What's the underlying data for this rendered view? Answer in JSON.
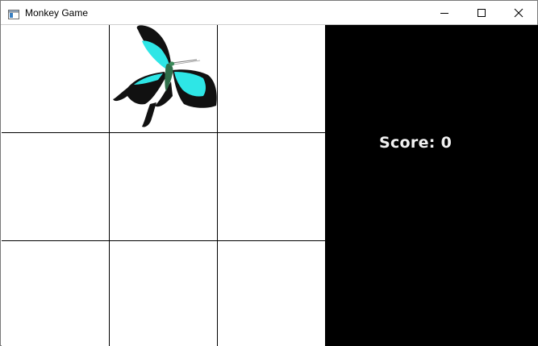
{
  "window": {
    "title": "Monkey Game",
    "controls": {
      "minimize_icon": "minimize-icon",
      "maximize_icon": "maximize-icon",
      "close_icon": "close-icon"
    }
  },
  "board": {
    "rows": 3,
    "cols": 3,
    "cells": [
      {
        "row": 0,
        "col": 0,
        "content": "empty"
      },
      {
        "row": 0,
        "col": 1,
        "content": "butterfly"
      },
      {
        "row": 0,
        "col": 2,
        "content": "empty"
      },
      {
        "row": 1,
        "col": 0,
        "content": "empty"
      },
      {
        "row": 1,
        "col": 1,
        "content": "empty"
      },
      {
        "row": 1,
        "col": 2,
        "content": "empty"
      },
      {
        "row": 2,
        "col": 0,
        "content": "empty"
      },
      {
        "row": 2,
        "col": 1,
        "content": "empty"
      },
      {
        "row": 2,
        "col": 2,
        "content": "empty"
      }
    ]
  },
  "sidebar": {
    "score_text": "Score: 0"
  },
  "colors": {
    "panel_background": "#000000",
    "score_text": "#f2f2f2",
    "butterfly_wing_accent": "#2ee6e6",
    "butterfly_wing_dark": "#111111"
  }
}
